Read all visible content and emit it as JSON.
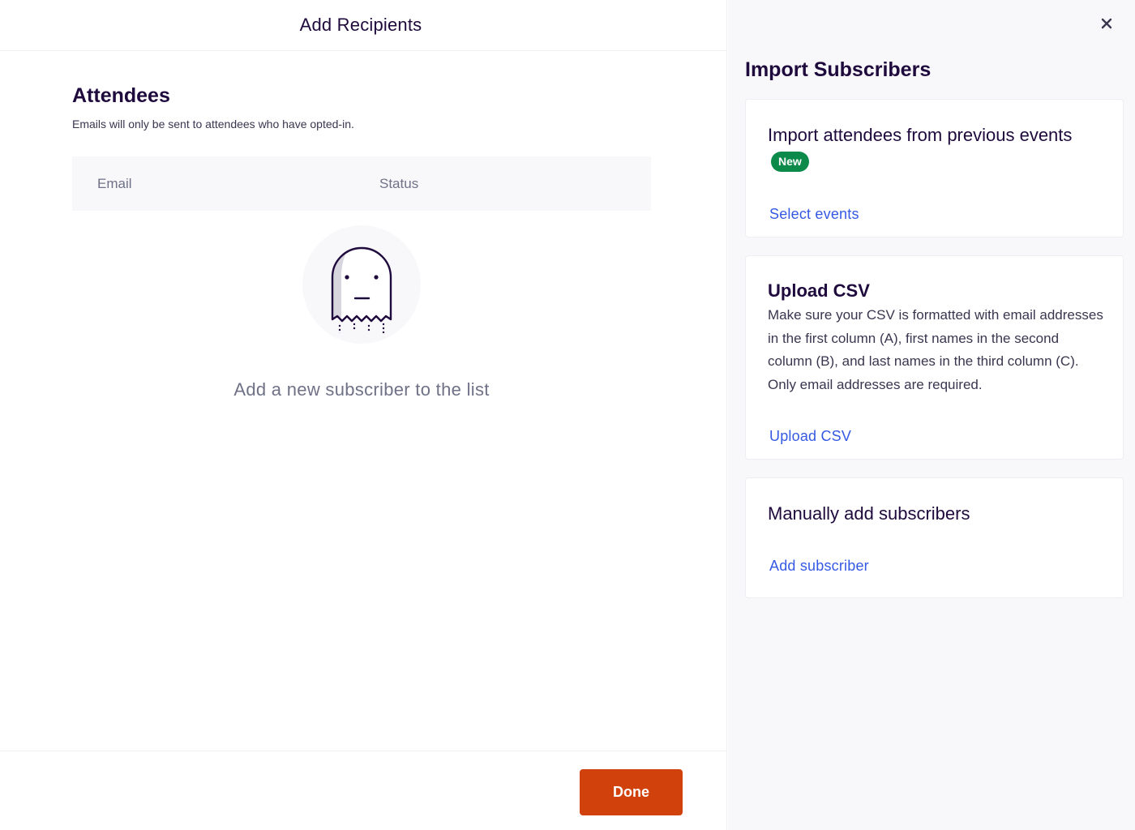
{
  "header": {
    "title": "Add Recipients"
  },
  "attendees": {
    "title": "Attendees",
    "subtitle": "Emails will only be sent to attendees who have opted-in.",
    "columns": [
      "Email",
      "Status"
    ],
    "empty_icon": "ghost-icon",
    "empty_text": "Add a new subscriber to the list"
  },
  "footer": {
    "done_label": "Done"
  },
  "side_panel": {
    "close_icon": "close-icon",
    "title": "Import Subscribers",
    "cards": [
      {
        "title": "Import attendees from previous events",
        "badge": "New",
        "link": "Select events"
      },
      {
        "title": "Upload CSV",
        "description": "Make sure your CSV is formatted with email addresses in the first column (A), first names in the second column (B), and last names in the third column (C). Only email addresses are required.",
        "link": "Upload CSV"
      },
      {
        "title": "Manually add subscribers",
        "link": "Add subscriber"
      }
    ]
  },
  "colors": {
    "primary_text": "#1e0a3c",
    "secondary_text": "#6f7287",
    "link": "#3659e3",
    "done_button": "#d1410c",
    "badge": "#0b8a4a",
    "panel_bg": "#f8f7fa"
  }
}
